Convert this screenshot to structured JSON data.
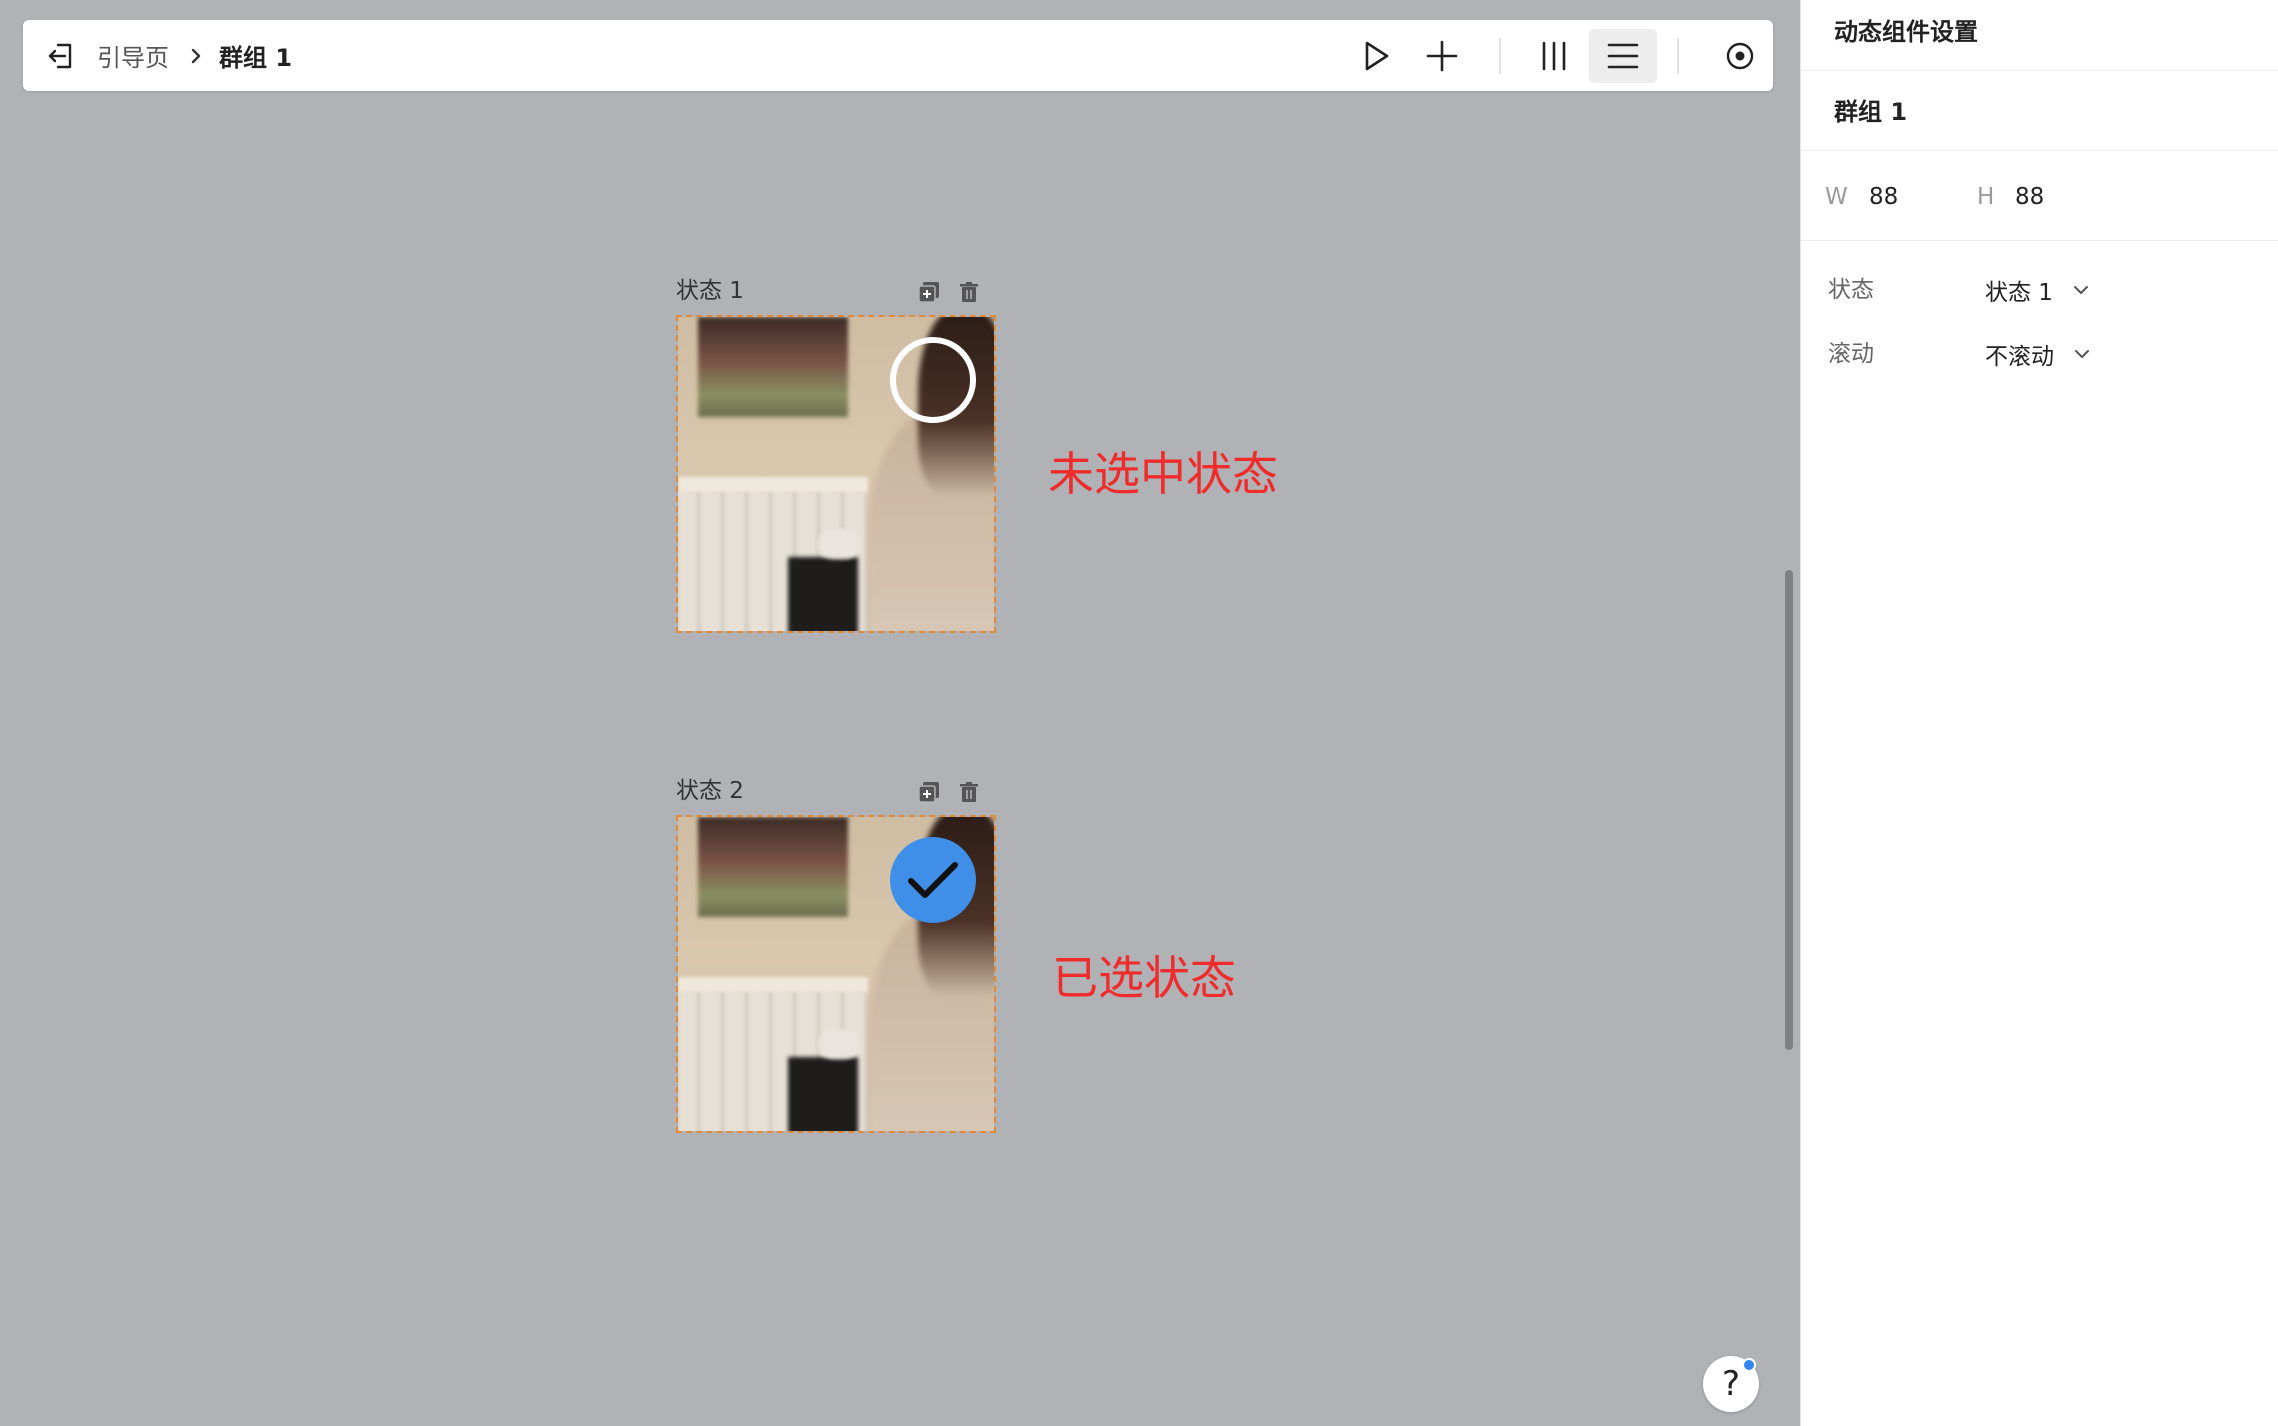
{
  "toolbar": {
    "breadcrumb_home": "引导页",
    "breadcrumb_current": "群组 1"
  },
  "states": [
    {
      "label": "状态 1",
      "annotation": "未选中状态"
    },
    {
      "label": "状态 2",
      "annotation": "已选状态"
    }
  ],
  "help": {
    "label": "?"
  },
  "panel": {
    "title": "动态组件设置",
    "group_name": "群组 1",
    "width_label": "W",
    "width_value": "88",
    "height_label": "H",
    "height_value": "88",
    "state_label": "状态",
    "state_value": "状态 1",
    "scroll_label": "滚动",
    "scroll_value": "不滚动"
  },
  "colors": {
    "canvas_bg": "#b1b2b6",
    "accent_blue": "#3f8ee8",
    "annotation_red": "#ef2b2b",
    "selection_border": "#e08a3a"
  },
  "icons": [
    "exit-icon",
    "chevron-right-icon",
    "play-icon",
    "plus-icon",
    "columns-icon",
    "menu-icon",
    "target-icon",
    "duplicate-icon",
    "trash-icon",
    "checkmark-icon",
    "chevron-down-icon"
  ]
}
